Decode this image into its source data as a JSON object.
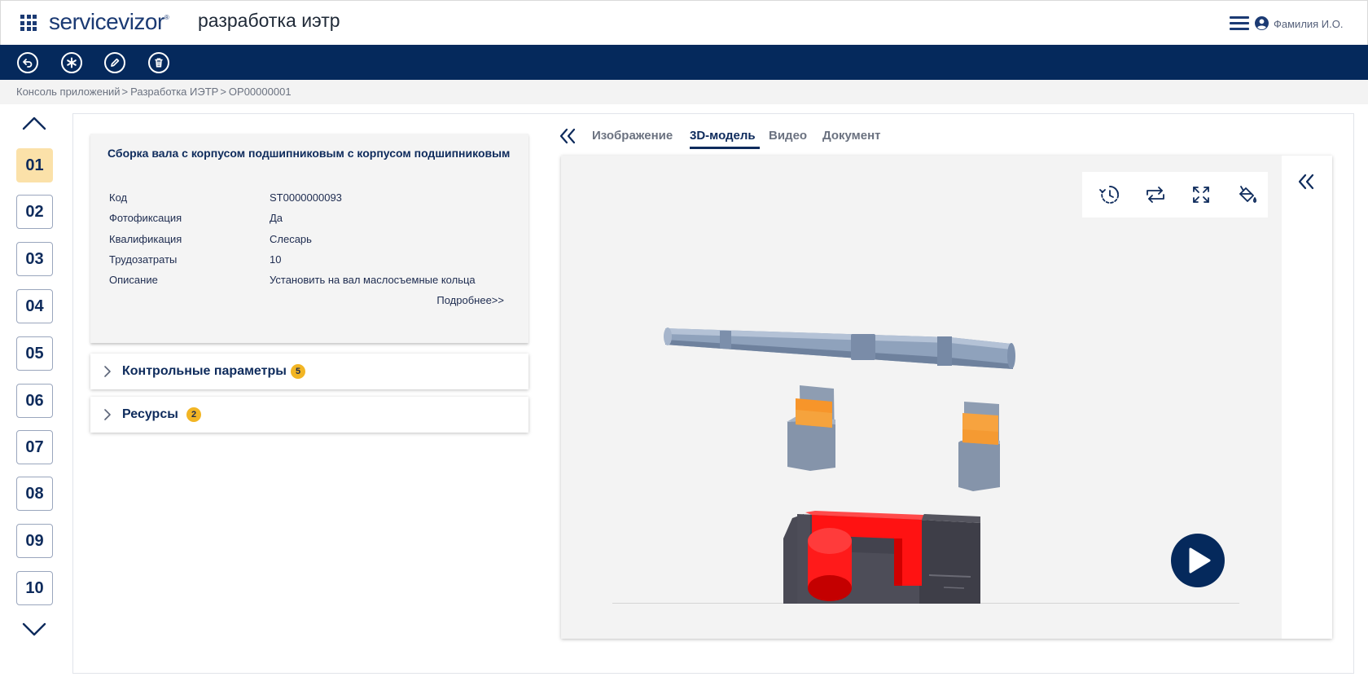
{
  "header": {
    "logo": "servicevizor",
    "logo_mark": "®",
    "app_title": "разработка иэтр",
    "user_name": "Фамилия И.О."
  },
  "toolbar": {
    "buttons": [
      {
        "name": "back-icon"
      },
      {
        "name": "asterisk-icon"
      },
      {
        "name": "edit-icon"
      },
      {
        "name": "trash-icon"
      }
    ]
  },
  "breadcrumb": {
    "items": [
      "Консоль приложений",
      "Разработка ИЭТР",
      "OP00000001"
    ],
    "separator": ">"
  },
  "steps": {
    "items": [
      "01",
      "02",
      "03",
      "04",
      "05",
      "06",
      "07",
      "08",
      "09",
      "10"
    ],
    "active": "01"
  },
  "operation": {
    "title": "Сборка вала с корпусом подшипниковым  с  корпусом подшипниковым",
    "fields": [
      {
        "label": "Код",
        "value": "ST0000000093"
      },
      {
        "label": "Фотофиксация",
        "value": "Да"
      },
      {
        "label": "Квалификация",
        "value": "Слесарь"
      },
      {
        "label": "Трудозатраты",
        "value": "10"
      },
      {
        "label": "Описание",
        "value": "Установить на вал маслосъемные кольца"
      }
    ],
    "more_link": "Подробнее>>"
  },
  "accordions": [
    {
      "label": "Контрольные параметры",
      "badge": "5"
    },
    {
      "label": "Ресурсы",
      "badge": "2"
    }
  ],
  "media": {
    "tabs": [
      "Изображение",
      "3D-модель",
      "Видео",
      "Документ"
    ],
    "active_tab": "3D-модель"
  },
  "viewer": {
    "tools": [
      "history-icon",
      "repeat-icon",
      "fullscreen-icon",
      "paint-bucket-icon"
    ]
  },
  "colors": {
    "brand": "#05295c",
    "accent_step": "#fbe1a9",
    "badge": "#f2b524"
  }
}
